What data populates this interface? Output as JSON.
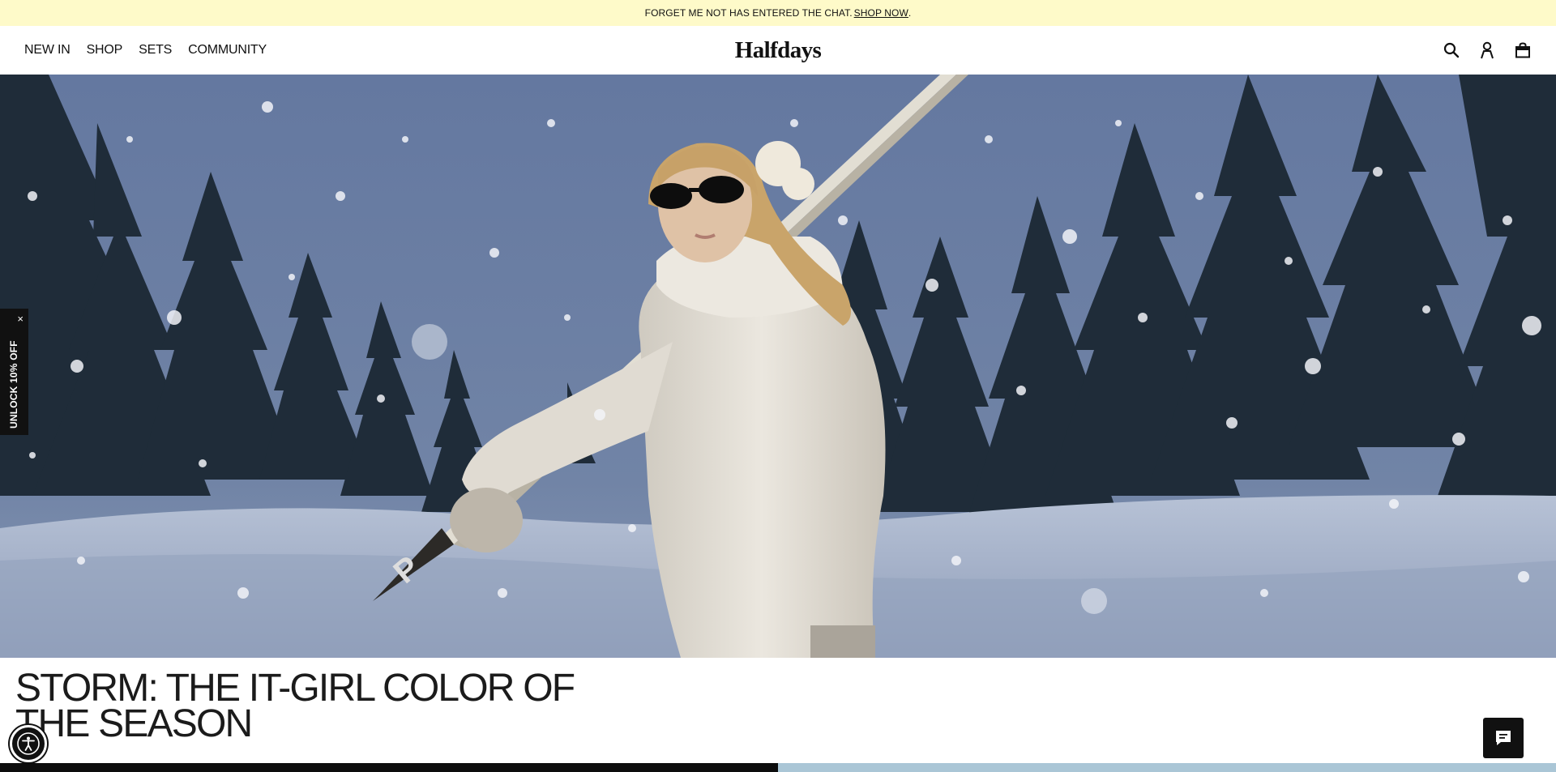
{
  "announcement": {
    "text": "FORGET ME NOT HAS ENTERED THE CHAT.",
    "cta": "SHOP NOW",
    "after": ".",
    "background": "#fefac9"
  },
  "nav": {
    "items": [
      "NEW IN",
      "SHOP",
      "SETS",
      "COMMUNITY"
    ]
  },
  "brand": {
    "logo": "Halfdays"
  },
  "header_icons": [
    "search-icon",
    "account-icon",
    "bag-icon"
  ],
  "hero": {
    "image": "woman in white puffer ski jacket carrying skis through falling snow among pine trees",
    "colors": {
      "sky": "#6b7fa0",
      "trees": "#1e2a36",
      "snow": "#dde3ee",
      "jacket": "#e4e0d8"
    }
  },
  "promo_tab": {
    "label": "UNLOCK 10% OFF",
    "close": "×"
  },
  "headline": "STORM: THE IT-GIRL COLOR OF THE SEASON",
  "widgets": {
    "accessibility": "accessibility-icon",
    "chat": "chat-icon"
  }
}
